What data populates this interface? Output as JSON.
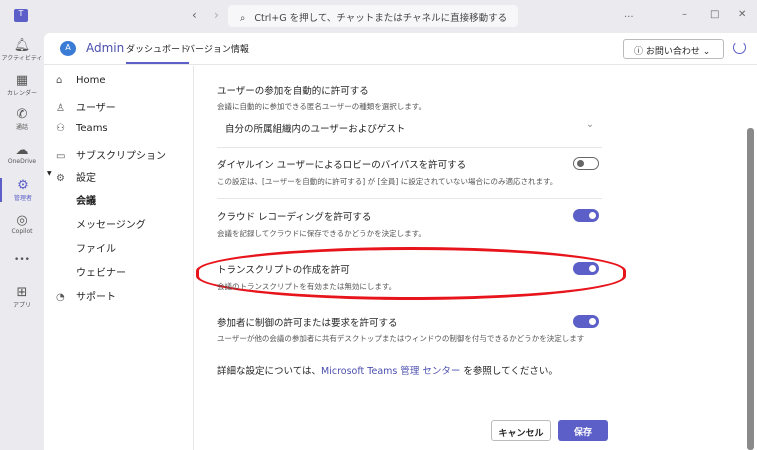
{
  "titlebar": {
    "search_placeholder": "Ctrl+G を押して、チャットまたはチャネルに直接移動する",
    "more": "...",
    "minimize": "–",
    "maximize": "□",
    "close": "✕"
  },
  "rail": [
    {
      "label": "アクティビティ",
      "icon": "bell"
    },
    {
      "label": "カレンダー",
      "icon": "calendar"
    },
    {
      "label": "通話",
      "icon": "phone"
    },
    {
      "label": "OneDrive",
      "icon": "cloud"
    },
    {
      "label": "管理者",
      "icon": "admin"
    },
    {
      "label": "Copilot",
      "icon": "copilot"
    },
    {
      "label": "•••",
      "icon": "more"
    },
    {
      "label": "アプリ",
      "icon": "plus"
    }
  ],
  "header": {
    "app": "Admin",
    "tabs": [
      "ダッシュボード",
      "バージョン情報"
    ],
    "contact": "お問い合わせ"
  },
  "nav": {
    "items": [
      "Home",
      "ユーザー",
      "Teams",
      "サブスクリプション",
      "設定"
    ],
    "sub": [
      "会議",
      "メッセージング",
      "ファイル",
      "ウェビナー"
    ],
    "support": "サポート"
  },
  "settings": [
    {
      "title": "ユーザーの参加を自動的に許可する",
      "desc": "会議に自動的に参加できる匿名ユーザーの種類を選択します。",
      "value": "自分の所属組織内のユーザーおよびゲスト"
    },
    {
      "title": "ダイヤルイン ユーザーによるロビーのバイパスを許可する",
      "desc": "この設定は、[ユーザーを自動的に許可する] が [全員] に設定されていない場合にのみ適応されます。",
      "on": false
    },
    {
      "title": "クラウド レコーディングを許可する",
      "desc": "会議を記録してクラウドに保存できるかどうかを決定します。",
      "on": true
    },
    {
      "title": "トランスクリプトの作成を許可",
      "desc": "会議のトランスクリプトを有効または無効にします。",
      "on": true
    },
    {
      "title": "参加者に制御の許可または要求を許可する",
      "desc": "ユーザーが他の会議の参加者に共有デスクトップまたはウィンドウの制御を付与できるかどうかを決定します",
      "on": true
    }
  ],
  "footer": {
    "prefix": "詳細な設定については、",
    "link": "Microsoft Teams 管理 センター",
    "suffix": "を参照してください。",
    "cancel": "キャンセル",
    "save": "保存"
  },
  "colors": {
    "accent": "#5b5fc7",
    "highlight": "#e8141b"
  }
}
